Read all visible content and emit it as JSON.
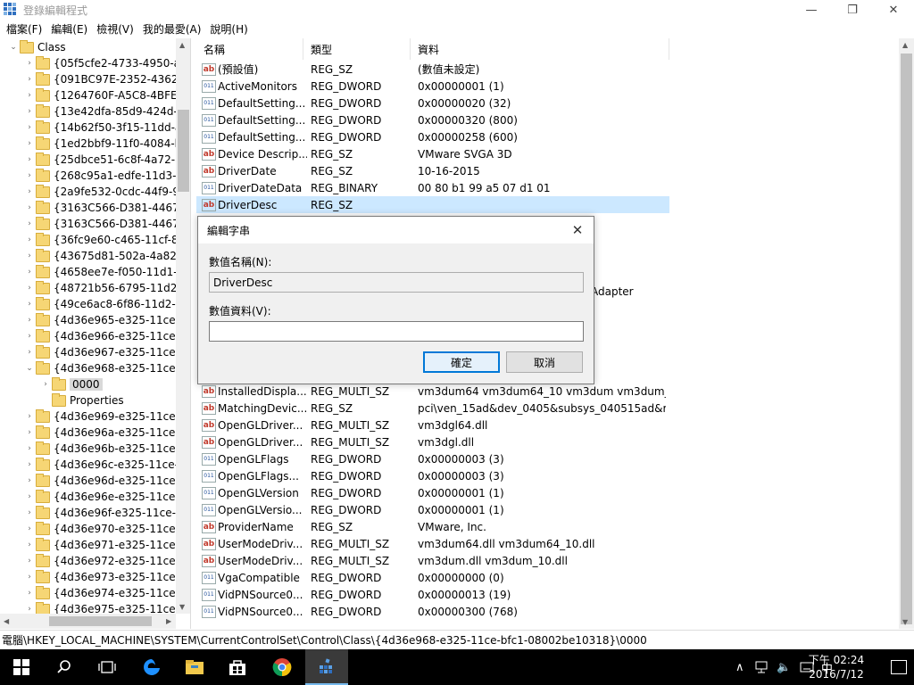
{
  "window": {
    "title": "登錄編輯程式",
    "minimize": "—",
    "maximize": "❐",
    "close": "✕"
  },
  "menu": [
    "檔案(F)",
    "編輯(E)",
    "檢視(V)",
    "我的最愛(A)",
    "說明(H)"
  ],
  "tree": {
    "root": "Class",
    "items": [
      "{05f5cfe2-4733-4950-a",
      "{091BC97E-2352-4362-",
      "{1264760F-A5C8-4BFE-",
      "{13e42dfa-85d9-424d-",
      "{14b62f50-3f15-11dd-a",
      "{1ed2bbf9-11f0-4084-b",
      "{25dbce51-6c8f-4a72-8",
      "{268c95a1-edfe-11d3-",
      "{2a9fe532-0cdc-44f9-9",
      "{3163C566-D381-4467",
      "{3163C566-D381-4467",
      "{36fc9e60-c465-11cf-8",
      "{43675d81-502a-4a82-",
      "{4658ee7e-f050-11d1-",
      "{48721b56-6795-11d2-",
      "{49ce6ac8-6f86-11d2-b",
      "{4d36e965-e325-11ce-",
      "{4d36e966-e325-11ce-",
      "{4d36e967-e325-11ce-",
      "{4d36e968-e325-11ce-"
    ],
    "child_selected": "0000",
    "child_properties": "Properties",
    "items_after": [
      "{4d36e969-e325-11ce-",
      "{4d36e96a-e325-11ce-",
      "{4d36e96b-e325-11ce-",
      "{4d36e96c-e325-11ce-",
      "{4d36e96d-e325-11ce-",
      "{4d36e96e-e325-11ce-",
      "{4d36e96f-e325-11ce-l",
      "{4d36e970-e325-11ce-",
      "{4d36e971-e325-11ce-",
      "{4d36e972-e325-11ce-",
      "{4d36e973-e325-11ce-",
      "{4d36e974-e325-11ce-",
      "{4d36e975-e325-11ce-"
    ]
  },
  "list": {
    "headers": [
      "名稱",
      "類型",
      "資料"
    ],
    "rows_top": [
      {
        "icon": "ab",
        "name": "(預設值)",
        "type": "REG_SZ",
        "data": "(數值未設定)"
      },
      {
        "icon": "bin",
        "name": "ActiveMonitors",
        "type": "REG_DWORD",
        "data": "0x00000001 (1)"
      },
      {
        "icon": "bin",
        "name": "DefaultSetting...",
        "type": "REG_DWORD",
        "data": "0x00000020 (32)"
      },
      {
        "icon": "bin",
        "name": "DefaultSetting...",
        "type": "REG_DWORD",
        "data": "0x00000320 (800)"
      },
      {
        "icon": "bin",
        "name": "DefaultSetting...",
        "type": "REG_DWORD",
        "data": "0x00000258 (600)"
      },
      {
        "icon": "ab",
        "name": "Device Descrip...",
        "type": "REG_SZ",
        "data": "VMware SVGA 3D"
      },
      {
        "icon": "ab",
        "name": "DriverDate",
        "type": "REG_SZ",
        "data": "10-16-2015"
      },
      {
        "icon": "bin",
        "name": "DriverDateData",
        "type": "REG_BINARY",
        "data": "00 80 b1 99 a5 07 d1 01"
      },
      {
        "icon": "ab",
        "name": "DriverDesc",
        "type": "REG_SZ",
        "data": ""
      }
    ],
    "partial_data": "Adapter",
    "rows_bottom": [
      {
        "icon": "ab",
        "name": "InstalledDispla...",
        "type": "REG_MULTI_SZ",
        "data": "vm3dum64 vm3dum64_10 vm3dum vm3dum_..."
      },
      {
        "icon": "ab",
        "name": "MatchingDevic...",
        "type": "REG_SZ",
        "data": "pci\\ven_15ad&dev_0405&subsys_040515ad&r..."
      },
      {
        "icon": "ab",
        "name": "OpenGLDriver...",
        "type": "REG_MULTI_SZ",
        "data": "vm3dgl64.dll"
      },
      {
        "icon": "ab",
        "name": "OpenGLDriver...",
        "type": "REG_MULTI_SZ",
        "data": "vm3dgl.dll"
      },
      {
        "icon": "bin",
        "name": "OpenGLFlags",
        "type": "REG_DWORD",
        "data": "0x00000003 (3)"
      },
      {
        "icon": "bin",
        "name": "OpenGLFlags...",
        "type": "REG_DWORD",
        "data": "0x00000003 (3)"
      },
      {
        "icon": "bin",
        "name": "OpenGLVersion",
        "type": "REG_DWORD",
        "data": "0x00000001 (1)"
      },
      {
        "icon": "bin",
        "name": "OpenGLVersio...",
        "type": "REG_DWORD",
        "data": "0x00000001 (1)"
      },
      {
        "icon": "ab",
        "name": "ProviderName",
        "type": "REG_SZ",
        "data": "VMware, Inc."
      },
      {
        "icon": "ab",
        "name": "UserModeDriv...",
        "type": "REG_MULTI_SZ",
        "data": "vm3dum64.dll vm3dum64_10.dll"
      },
      {
        "icon": "ab",
        "name": "UserModeDriv...",
        "type": "REG_MULTI_SZ",
        "data": "vm3dum.dll vm3dum_10.dll"
      },
      {
        "icon": "bin",
        "name": "VgaCompatible",
        "type": "REG_DWORD",
        "data": "0x00000000 (0)"
      },
      {
        "icon": "bin",
        "name": "VidPNSource0...",
        "type": "REG_DWORD",
        "data": "0x00000013 (19)"
      },
      {
        "icon": "bin",
        "name": "VidPNSource0...",
        "type": "REG_DWORD",
        "data": "0x00000300 (768)"
      }
    ]
  },
  "dialog": {
    "title": "編輯字串",
    "close": "✕",
    "name_label": "數值名稱(N):",
    "name_value": "DriverDesc",
    "data_label": "數值資料(V):",
    "data_value": "",
    "ok": "確定",
    "cancel": "取消"
  },
  "status": "電腦\\HKEY_LOCAL_MACHINE\\SYSTEM\\CurrentControlSet\\Control\\Class\\{4d36e968-e325-11ce-bfc1-08002be10318}\\0000",
  "taskbar": {
    "time": "下午 02:24",
    "date": "2016/7/12",
    "ime": "中"
  },
  "colors": {
    "selection": "#cce8ff",
    "accent": "#0078d7",
    "taskbar": "#000000"
  }
}
